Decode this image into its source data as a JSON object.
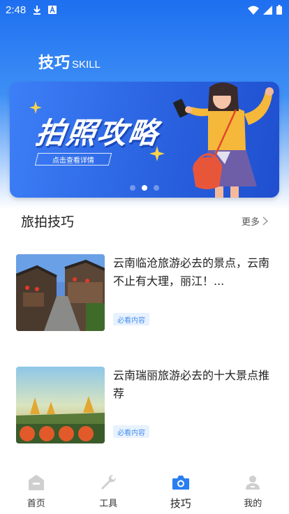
{
  "status_bar": {
    "time": "2:48"
  },
  "header": {
    "title": "技巧",
    "subtitle": "SKILL"
  },
  "banner": {
    "title": "拍照攻略",
    "link_label": "点击查看详情",
    "dots": [
      false,
      true,
      false
    ]
  },
  "section": {
    "title": "旅拍技巧",
    "more_label": "更多"
  },
  "articles": [
    {
      "title": "云南临沧旅游必去的景点，云南不止有大理，丽江！...",
      "tag": "必看内容"
    },
    {
      "title": "云南瑞丽旅游必去的十大景点推荐",
      "tag": "必看内容"
    }
  ],
  "tabs": [
    {
      "label": "首页",
      "icon": "home-icon",
      "active": false
    },
    {
      "label": "工具",
      "icon": "wrench-icon",
      "active": false
    },
    {
      "label": "技巧",
      "icon": "camera-icon",
      "active": true
    },
    {
      "label": "我的",
      "icon": "user-icon",
      "active": false
    }
  ],
  "colors": {
    "accent": "#2a7ef0",
    "inactive_icon": "#cfcfcf",
    "tag_bg": "#e8f2fe",
    "tag_text": "#4a8ff0"
  }
}
